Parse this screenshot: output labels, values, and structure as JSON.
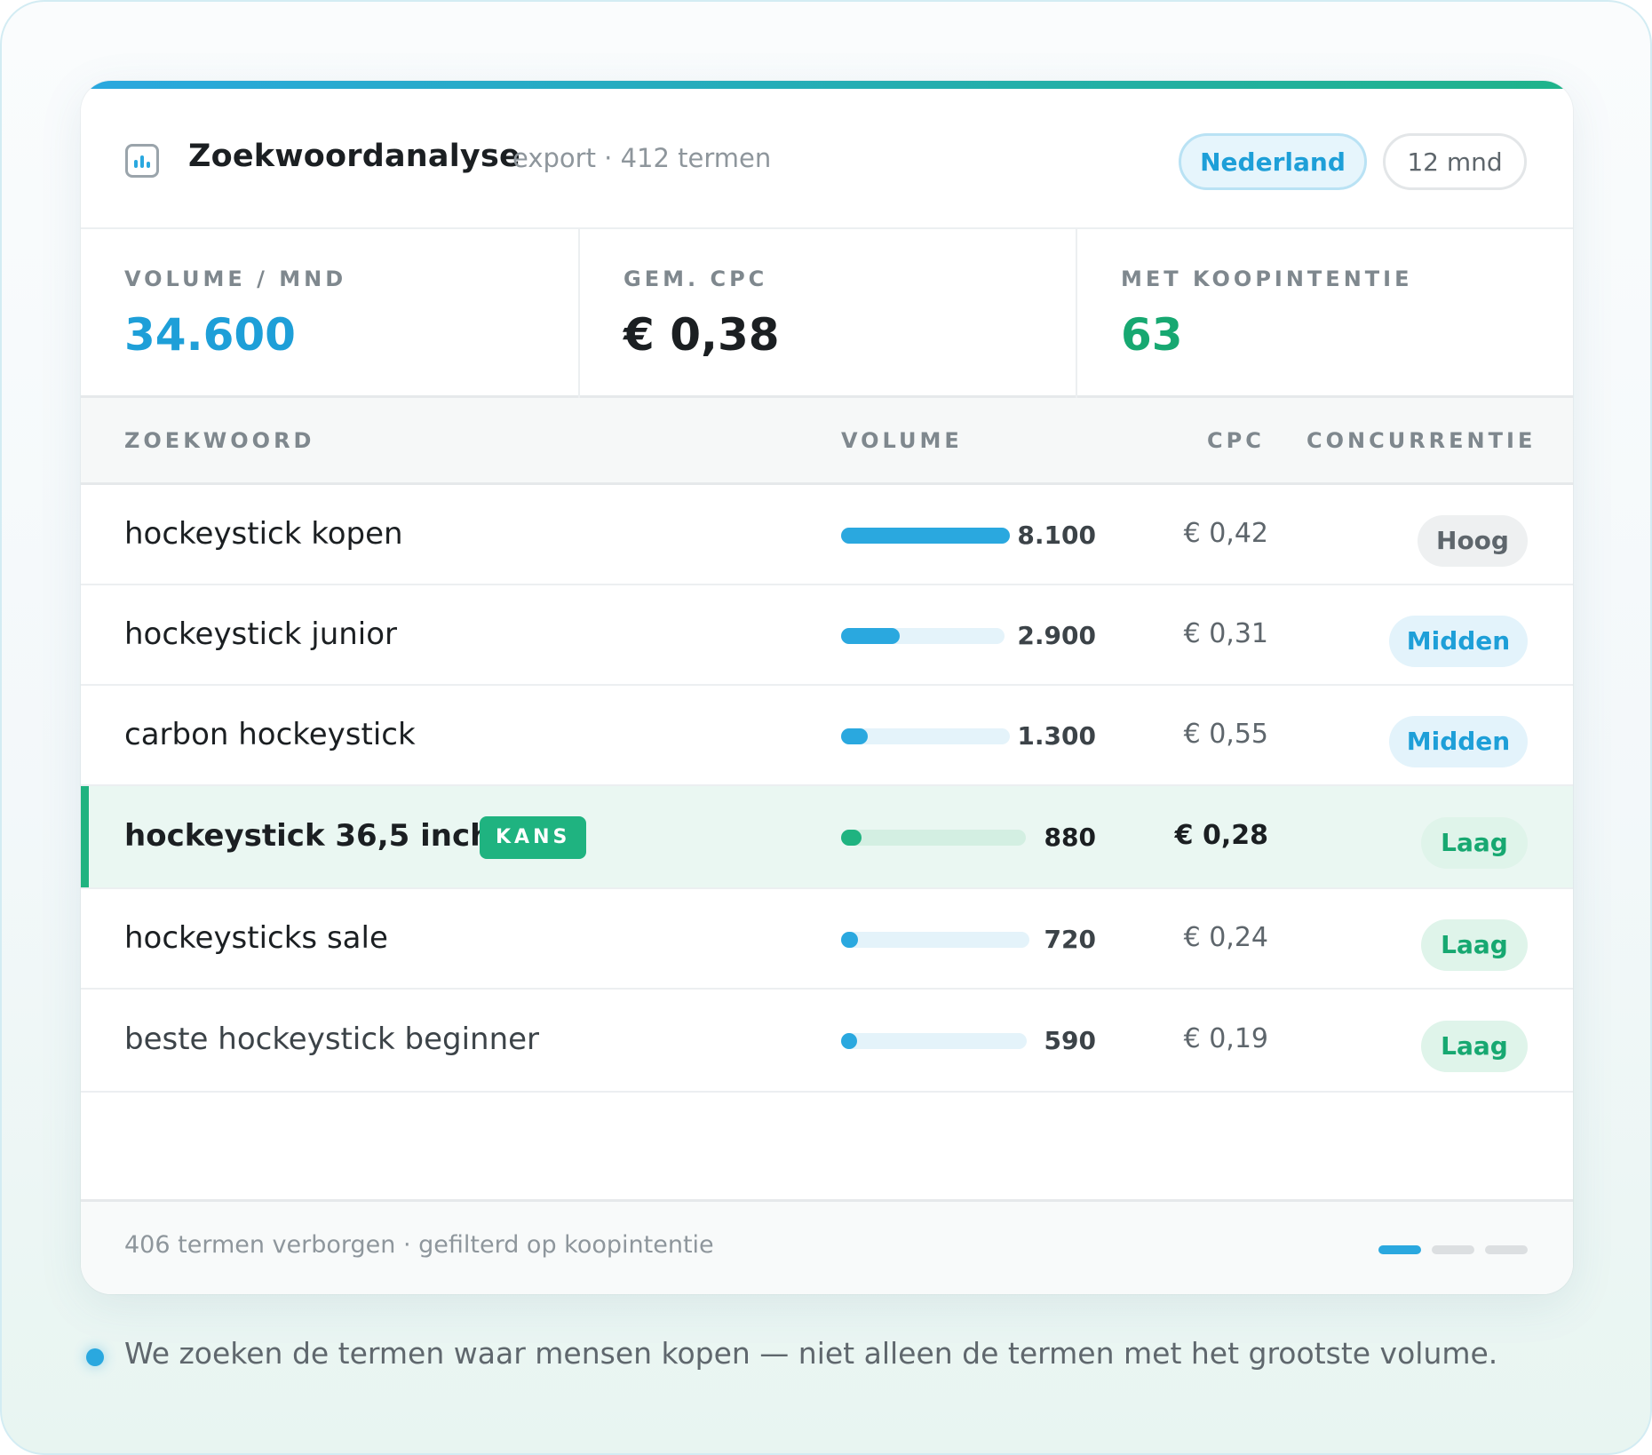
{
  "header": {
    "icon": "bar-chart-icon",
    "title": "Zoekwoordanalyse",
    "subtitle": "export · 412 termen",
    "country_pill": "Nederland",
    "period_pill": "12 mnd"
  },
  "stats": [
    {
      "label": "VOLUME / MND",
      "value": "34.600",
      "color": "#1e9fd8"
    },
    {
      "label": "GEM. CPC",
      "value": "€ 0,38",
      "color": "#1b1f22"
    },
    {
      "label": "MET KOOPINTENTIE",
      "value": "63",
      "color": "#17a871"
    }
  ],
  "table": {
    "columns": [
      "ZOEKWOORD",
      "VOLUME",
      "CPC",
      "CONCURRENTIE"
    ],
    "rows": [
      {
        "keyword": "hockeystick kopen",
        "volume": "8.100",
        "volume_share": 1.0,
        "cpc": "€ 0,42",
        "competition": "Hoog",
        "level": "hoog",
        "highlight": false,
        "tag": ""
      },
      {
        "keyword": "hockeystick junior",
        "volume": "2.900",
        "volume_share": 0.358,
        "cpc": "€ 0,31",
        "competition": "Midden",
        "level": "midden",
        "highlight": false,
        "tag": ""
      },
      {
        "keyword": "carbon hockeystick",
        "volume": "1.300",
        "volume_share": 0.16,
        "cpc": "€ 0,55",
        "competition": "Midden",
        "level": "midden",
        "highlight": false,
        "tag": ""
      },
      {
        "keyword": "hockeystick 36,5 inch",
        "volume": "880",
        "volume_share": 0.109,
        "cpc": "€ 0,28",
        "competition": "Laag",
        "level": "laag",
        "highlight": true,
        "tag": "KANS"
      },
      {
        "keyword": "hockeysticks sale",
        "volume": "720",
        "volume_share": 0.089,
        "cpc": "€ 0,24",
        "competition": "Laag",
        "level": "laag",
        "highlight": false,
        "tag": ""
      },
      {
        "keyword": "beste hockeystick beginner",
        "volume": "590",
        "volume_share": 0.073,
        "cpc": "€ 0,19",
        "competition": "Laag",
        "level": "laag",
        "highlight": false,
        "tag": ""
      }
    ]
  },
  "footer": {
    "text": "406 termen verborgen · gefilterd op koopintentie",
    "pages": 3,
    "active_page": 1
  },
  "caption": "We zoeken de termen waar mensen kopen — niet alleen de termen met het grootste volume.",
  "colors": {
    "accent_blue": "#2aa8df",
    "accent_green": "#1fb380"
  }
}
